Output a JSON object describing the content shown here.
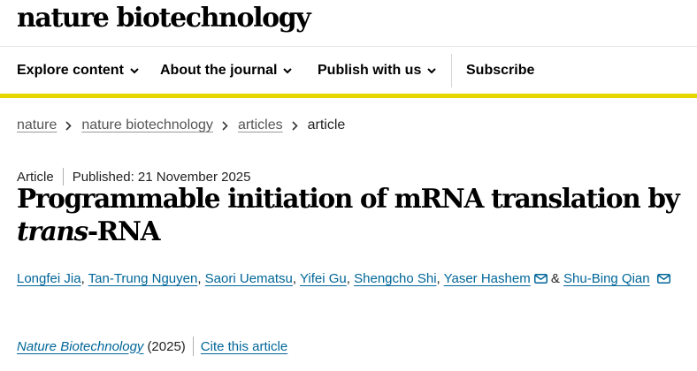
{
  "header": {
    "logo": "nature biotechnology"
  },
  "nav": {
    "items": [
      {
        "label": "Explore content",
        "has_dropdown": true
      },
      {
        "label": "About the journal",
        "has_dropdown": true
      },
      {
        "label": "Publish with us",
        "has_dropdown": true
      },
      {
        "label": "Subscribe",
        "has_dropdown": false
      }
    ],
    "accent_color": "#e6d600"
  },
  "breadcrumb": {
    "items": [
      {
        "label": "nature",
        "link": true
      },
      {
        "label": "nature biotechnology",
        "link": true
      },
      {
        "label": "articles",
        "link": true
      },
      {
        "label": "article",
        "link": false
      }
    ]
  },
  "article": {
    "type": "Article",
    "published": "Published: 21 November 2025",
    "title_main": "Programmable initiation of mRNA translation by ",
    "title_italic": "trans",
    "title_end": "-RNA",
    "authors": [
      {
        "name": "Longfei Jia",
        "separator": ", ",
        "email": false
      },
      {
        "name": "Tan-Trung Nguyen",
        "separator": ", ",
        "email": false
      },
      {
        "name": "Saori Uematsu",
        "separator": ", ",
        "email": false
      },
      {
        "name": "Yifei Gu",
        "separator": ", ",
        "email": false
      },
      {
        "name": "Shengcho Shi",
        "separator": ", ",
        "email": false
      },
      {
        "name": "Yaser Hashem",
        "separator": " & ",
        "email": true
      },
      {
        "name": "Shu-Bing Qian",
        "separator": "",
        "email": true
      }
    ],
    "journal": "Nature Biotechnology",
    "year": "(2025)",
    "cite_label": "Cite this article",
    "link_color": "#006699"
  }
}
